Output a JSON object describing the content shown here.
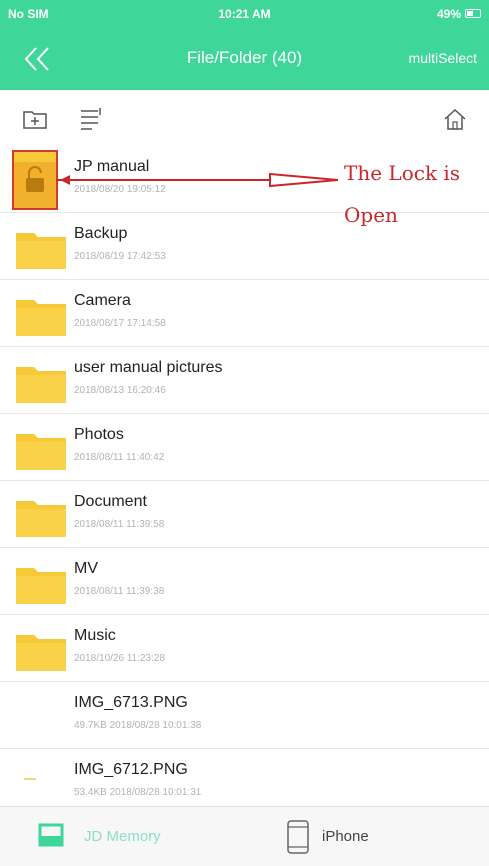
{
  "status_bar": {
    "carrier": "No SIM",
    "time": "10:21 AM",
    "battery": "49%"
  },
  "nav": {
    "title": "File/Folder (40)",
    "multi_select": "multiSelect"
  },
  "files": [
    {
      "name": "JP manual",
      "meta": "2018/08/20 19:05:12",
      "type": "locked-folder"
    },
    {
      "name": "Backup",
      "meta": "2018/08/19 17:42:53",
      "type": "folder"
    },
    {
      "name": "Camera",
      "meta": "2018/08/17 17:14:58",
      "type": "folder"
    },
    {
      "name": "user manual pictures",
      "meta": "2018/08/13 16:20:46",
      "type": "folder"
    },
    {
      "name": "Photos",
      "meta": "2018/08/11 11:40:42",
      "type": "folder"
    },
    {
      "name": "Document",
      "meta": "2018/08/11 11:39:58",
      "type": "folder"
    },
    {
      "name": "MV",
      "meta": "2018/08/11 11:39:38",
      "type": "folder"
    },
    {
      "name": "Music",
      "meta": "2018/10/26 11:23:28",
      "type": "folder"
    },
    {
      "name": "IMG_6713.PNG",
      "meta": "49.7KB 2018/08/28 10:01:38",
      "type": "image"
    },
    {
      "name": "IMG_6712.PNG",
      "meta": "53.4KB 2018/08/28 10:01:31",
      "type": "image"
    }
  ],
  "annotation": {
    "line1": "The Lock is",
    "line2": "Open",
    "color": "#c8282d"
  },
  "tabs": [
    {
      "label": "JD Memory",
      "active": true
    },
    {
      "label": "iPhone",
      "active": false
    }
  ],
  "colors": {
    "accent": "#3fd69a",
    "folder": "#f6c938",
    "lock": "#f1b12c"
  }
}
